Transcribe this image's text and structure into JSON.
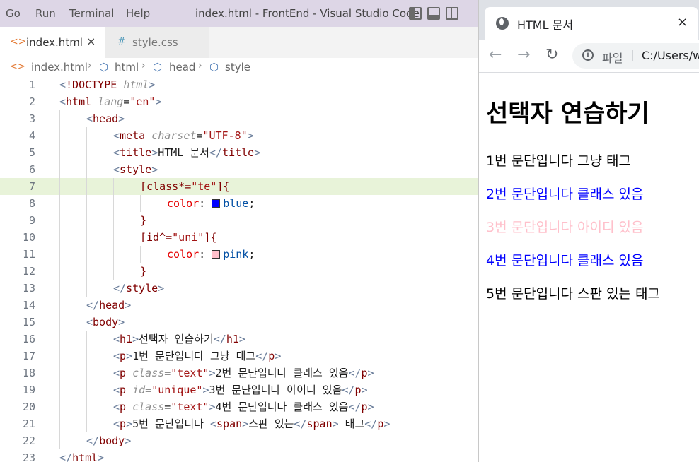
{
  "vscode": {
    "menu": [
      "Go",
      "Run",
      "Terminal",
      "Help"
    ],
    "window_title": "index.html - FrontEnd - Visual Studio Code",
    "tabs": [
      {
        "icon": "<>",
        "label": "index.html",
        "close": "×"
      },
      {
        "icon": "#",
        "label": "style.css"
      }
    ],
    "breadcrumb": [
      "index.html",
      "html",
      "head",
      "style"
    ],
    "lines": [
      {
        "n": "1"
      },
      {
        "n": "2"
      },
      {
        "n": "3"
      },
      {
        "n": "4"
      },
      {
        "n": "5"
      },
      {
        "n": "6"
      },
      {
        "n": "7"
      },
      {
        "n": "8"
      },
      {
        "n": "9"
      },
      {
        "n": "10"
      },
      {
        "n": "11"
      },
      {
        "n": "12"
      },
      {
        "n": "13"
      },
      {
        "n": "14"
      },
      {
        "n": "15"
      },
      {
        "n": "16"
      },
      {
        "n": "17"
      },
      {
        "n": "18"
      },
      {
        "n": "19"
      },
      {
        "n": "20"
      },
      {
        "n": "21"
      },
      {
        "n": "22"
      },
      {
        "n": "23"
      }
    ],
    "code": {
      "doctype": "!DOCTYPE",
      "html_kw": "html",
      "lang_attr": "lang",
      "lang_val": "\"en\"",
      "head": "head",
      "meta": "meta",
      "charset_attr": "charset",
      "charset_val": "\"UTF-8\"",
      "title": "title",
      "title_text": "HTML 문서",
      "style": "style",
      "sel1_a": "[class*=",
      "sel1_b": "\"te\"",
      "sel1_c": "]{",
      "prop_color": "color",
      "colon": ":",
      "val_blue": "blue",
      "semi": ";",
      "close_brace": "}",
      "sel2_a": "[id^=",
      "sel2_b": "\"uni\"",
      "sel2_c": "]{",
      "val_pink": "pink",
      "body": "body",
      "h1": "h1",
      "h1_text": "선택자 연습하기",
      "p": "p",
      "p1_text": "1번 문단입니다 그냥 태그",
      "class_attr": "class",
      "class_val": "\"text\"",
      "p2_text": "2번 문단입니다 클래스 있음",
      "id_attr": "id",
      "id_val": "\"unique\"",
      "p3_text": "3번 문단입니다 아이디 있음",
      "p4_text": "4번 문단입니다 클래스 있음",
      "p5_a": "5번 문단입니다 ",
      "span": "span",
      "span_text": "스판 있는",
      "p5_b": " 태그"
    },
    "swatch_blue": "#0000ff",
    "swatch_pink": "#ffc0cb"
  },
  "browser": {
    "tab_title": "HTML 문서",
    "tab_close": "×",
    "back": "←",
    "forward": "→",
    "reload": "↻",
    "info": "i",
    "omnibox_label": "파일",
    "omnibox_sep": "|",
    "omnibox_url": "C:/Users/w",
    "page": {
      "h1": "선택자 연습하기",
      "paragraphs": [
        {
          "text": "1번 문단입니다 그냥 태그",
          "color": "#000000"
        },
        {
          "text": "2번 문단입니다 클래스 있음",
          "color": "#0000ff"
        },
        {
          "text": "3번 문단입니다 아이디 있음",
          "color": "#ffc0cb"
        },
        {
          "text": "4번 문단입니다 클래스 있음",
          "color": "#0000ff"
        },
        {
          "text": "5번 문단입니다 스판 있는 태그",
          "color": "#000000"
        }
      ]
    }
  }
}
